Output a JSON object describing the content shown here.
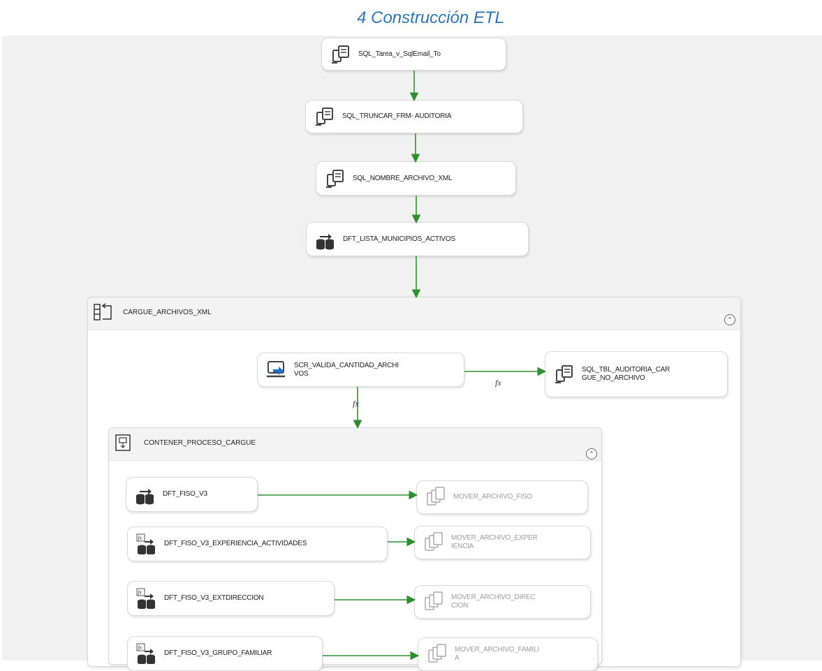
{
  "caption": "4 Construcción ETL",
  "tasks": {
    "sql_tarea": "SQL_Tarea_v_SqlEmail_To",
    "sql_truncar": "SQL_TRUNCAR_FRM- AUDITORIA",
    "sql_nombre": "SQL_NOMBRE_ARCHIVO_XML",
    "dft_lista": "DFT_LISTA_MUNICIPIOS_ACTIVOS",
    "scr_valida": "SCR_VALIDA_CANTIDAD_ARCHI\nVOS",
    "sql_tbl_auditoria": "SQL_TBL_AUDITORIA_CAR\nGUE_NO_ARCHIVO",
    "dft_fiso": "DFT_FISO_V3",
    "mover_fiso": "MOVER_ARCHIVO_FISO",
    "dft_experiencia": "DFT_FISO_V3_EXPERIENCIA_ACTIVIDADES",
    "mover_experiencia": "MOVER_ARCHIVO_EXPER\nIENCIA",
    "dft_extdireccion": "DFT_FISO_V3_EXTDIRECCION",
    "mover_direccion": "MOVER_ARCHIVO_DIREC\nCION",
    "dft_grupo": "DFT_FISO_V3_GRUPO_FAMILIAR",
    "mover_familia": "MOVER_ARCHIVO_FAMILI\nA"
  },
  "containers": {
    "cargue": "CARGUE_ARCHIVOS_XML",
    "contener": "CONTENER_PROCESO_CARGUE"
  },
  "expression_marker": "fx",
  "collapse_glyph": "⌃",
  "colors": {
    "precedence": "#2f8f2f",
    "caption": "#2e75b6",
    "canvas": "#f1f1f1"
  }
}
